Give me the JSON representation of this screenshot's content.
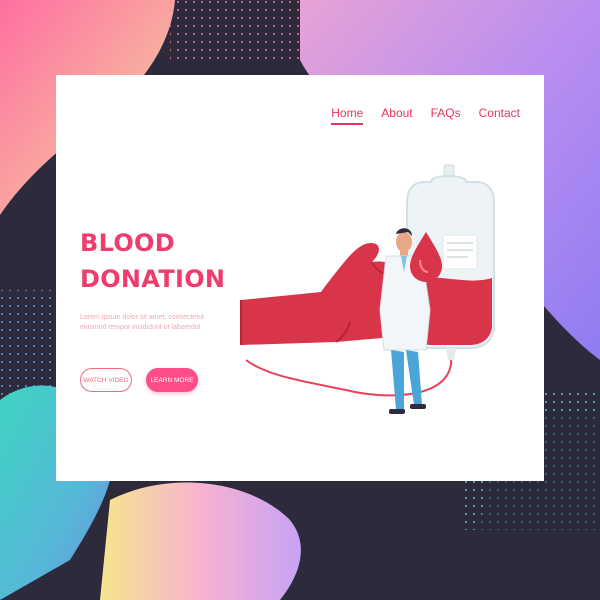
{
  "nav": {
    "items": [
      {
        "label": "Home",
        "active": true
      },
      {
        "label": "About",
        "active": false
      },
      {
        "label": "FAQs",
        "active": false
      },
      {
        "label": "Contact",
        "active": false
      }
    ]
  },
  "hero": {
    "title_line1": "BLOOD",
    "title_line2": "DONATION",
    "description": "Lorem ipsum dolor sit amet, consectetur eiusmod tempor incididunt ut laboredol",
    "watch_button": "WATCH VIDEO",
    "learn_button": "LEARN MORE"
  },
  "colors": {
    "accent": "#ee3d6c",
    "button_pink": "#ff4d8a",
    "blood_red": "#d8344a"
  }
}
